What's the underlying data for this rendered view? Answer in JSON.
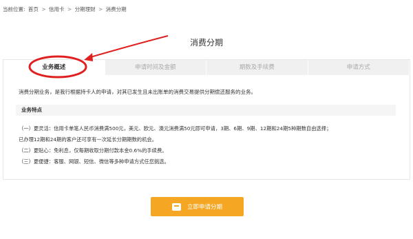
{
  "breadcrumb": {
    "label": "当前位置:",
    "items": [
      "首页",
      "信用卡",
      "分期理财",
      "消费分期"
    ],
    "separator": ">"
  },
  "page_title": "消费分期",
  "tabs": [
    {
      "label": "业务概述",
      "active": true
    },
    {
      "label": "申请时间及金额",
      "active": false
    },
    {
      "label": "期数及手续费",
      "active": false
    },
    {
      "label": "申请方式",
      "active": false
    }
  ],
  "content": {
    "intro": "消费分期业务，是我行根据持卡人的申请，对其已发生且未出账单的消费交易提供分期偿还服务的业务。",
    "features_heading": "业务特点",
    "features": [
      "（一）更灵活：信用卡单笔人民币消费满500元，美元、欧元、澳元消费满50元即可申请，3期、6期、9期、12期和24期5种期数自由选择；",
      "已办理12期和24期的客户还可享有一次延长分期期数的机会。",
      "（二）更贴心：免利息，仅每期收取分期付款本金0.6%的手续费。",
      "（三）更便捷：客服、网银、短信、微信等多种申请方式任您挑选。"
    ]
  },
  "apply_button": {
    "label": "立即申请分期",
    "icon": "apply-icon"
  },
  "colors": {
    "accent": "#f5a623",
    "annotation": "#e02020"
  }
}
